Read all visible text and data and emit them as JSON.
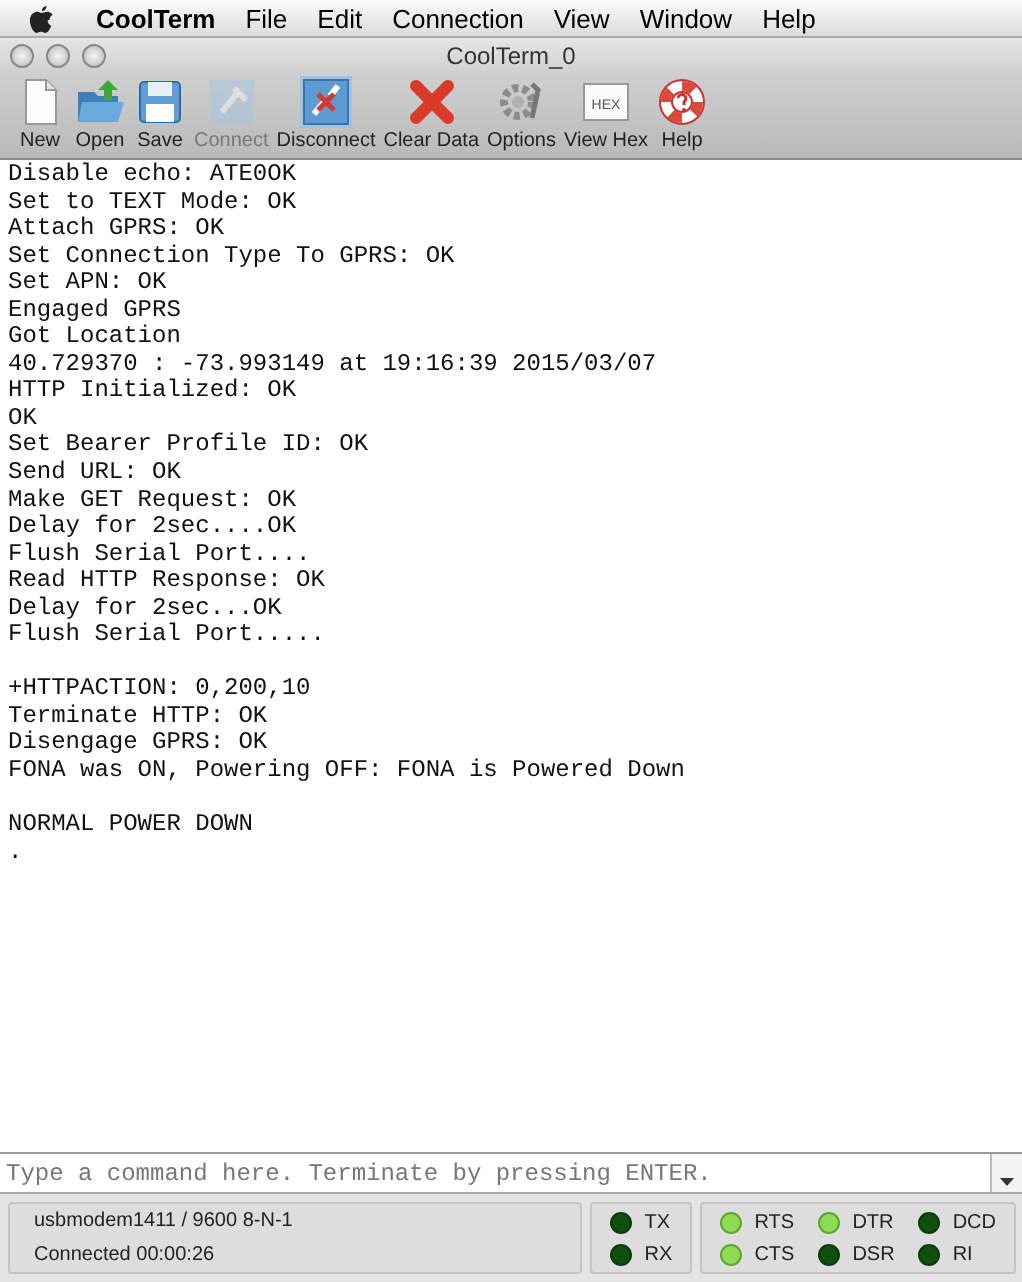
{
  "menu_bar": {
    "app": "CoolTerm",
    "items": [
      "File",
      "Edit",
      "Connection",
      "View",
      "Window",
      "Help"
    ]
  },
  "window": {
    "title": "CoolTerm_0"
  },
  "toolbar": [
    {
      "kind": "new",
      "label": "New",
      "disabled": false,
      "pressed": false
    },
    {
      "kind": "open",
      "label": "Open",
      "disabled": false,
      "pressed": false
    },
    {
      "kind": "save",
      "label": "Save",
      "disabled": false,
      "pressed": false
    },
    {
      "kind": "connect",
      "label": "Connect",
      "disabled": true,
      "pressed": false
    },
    {
      "kind": "disconnect",
      "label": "Disconnect",
      "disabled": false,
      "pressed": true
    },
    {
      "kind": "clear",
      "label": "Clear Data",
      "disabled": false,
      "pressed": false
    },
    {
      "kind": "options",
      "label": "Options",
      "disabled": false,
      "pressed": false
    },
    {
      "kind": "hex",
      "label": "View Hex",
      "icon_text": "HEX",
      "disabled": false,
      "pressed": false
    },
    {
      "kind": "help",
      "label": "Help",
      "disabled": false,
      "pressed": false
    }
  ],
  "terminal": {
    "blocks": [
      [
        "Disable echo: ATE0OK",
        "Set to TEXT Mode: OK",
        "Attach GPRS: OK",
        "Set Connection Type To GPRS: OK",
        "Set APN: OK",
        "Engaged GPRS",
        "Got Location",
        "40.729370 : -73.993149 at 19:16:39 2015/03/07",
        "HTTP Initialized: OK",
        "OK",
        "Set Bearer Profile ID: OK",
        "Send URL: OK",
        "Make GET Request: OK",
        "Delay for 2sec....OK",
        "Flush Serial Port....",
        "Read HTTP Response: OK",
        "Delay for 2sec...OK",
        "Flush Serial Port....."
      ],
      [
        "+HTTPACTION: 0,200,10",
        "Terminate HTTP: OK",
        "Disengage GPRS: OK",
        "FONA was ON, Powering OFF: FONA is Powered Down"
      ],
      [
        "NORMAL POWER DOWN",
        "."
      ]
    ]
  },
  "command_input": {
    "placeholder": "Type a command here. Terminate by pressing ENTER."
  },
  "status_bar": {
    "port": "usbmodem1411 / 9600 8-N-1",
    "connection": "Connected 00:00:26",
    "data_leds": [
      {
        "label": "TX",
        "on": false
      },
      {
        "label": "RX",
        "on": false
      }
    ],
    "line_leds": [
      {
        "label": "RTS",
        "on": true
      },
      {
        "label": "DTR",
        "on": true
      },
      {
        "label": "DCD",
        "on": false
      },
      {
        "label": "CTS",
        "on": true
      },
      {
        "label": "DSR",
        "on": false
      },
      {
        "label": "RI",
        "on": false
      }
    ]
  }
}
